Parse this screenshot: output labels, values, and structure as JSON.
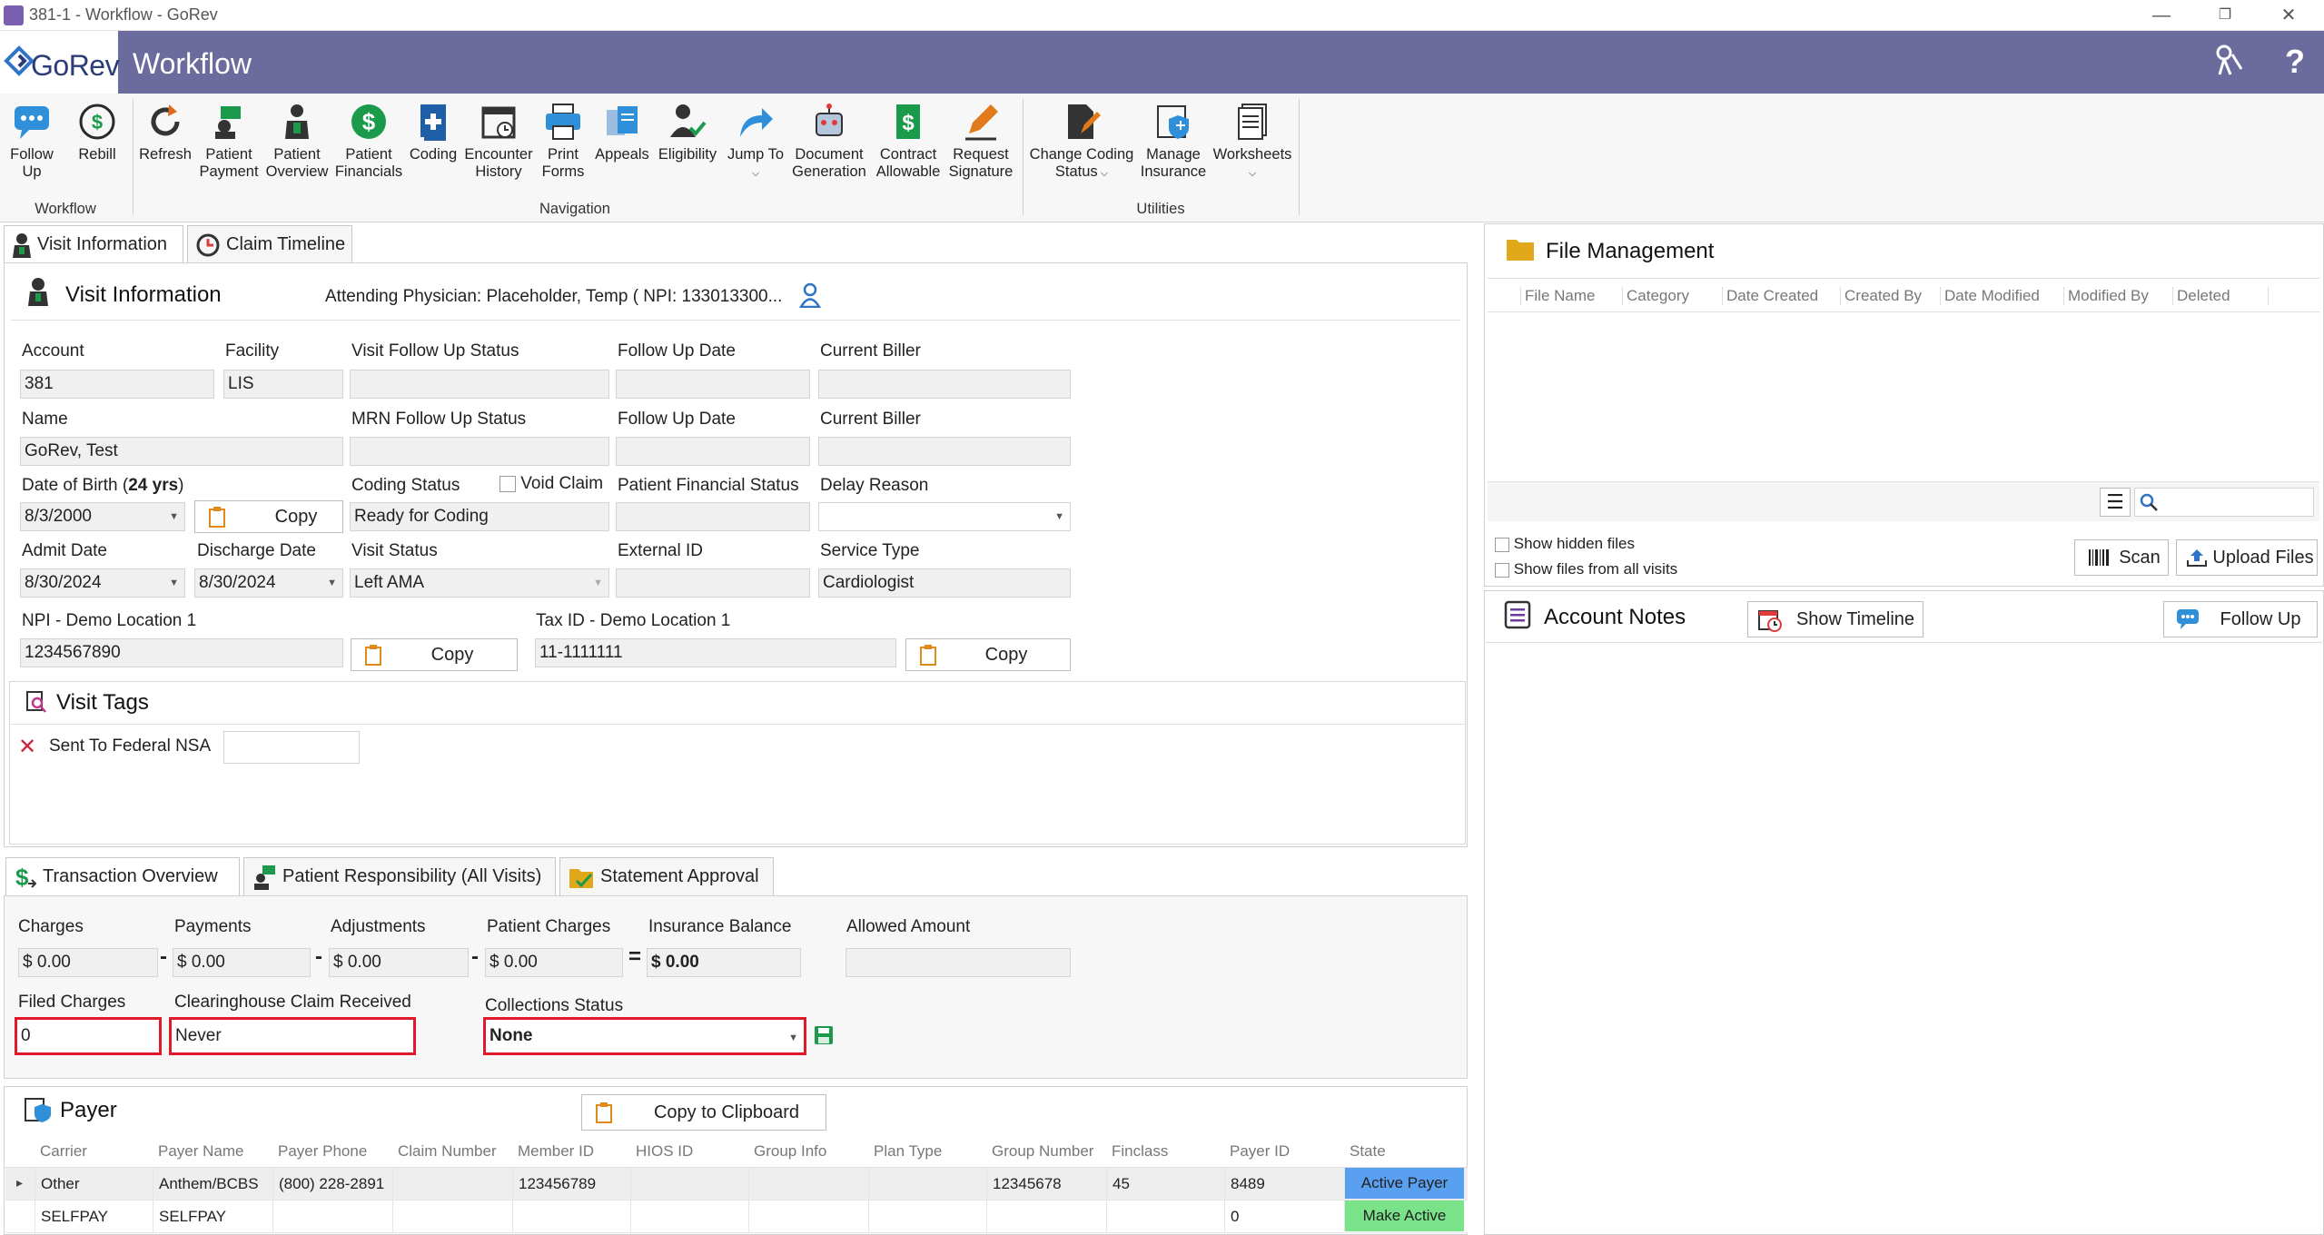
{
  "window": {
    "title": "381-1 - Workflow - GoRev"
  },
  "header": {
    "logo_text": "GoRev",
    "title": "Workflow"
  },
  "ribbon": {
    "groups": {
      "workflow": "Workflow",
      "navigation": "Navigation",
      "utilities": "Utilities"
    },
    "buttons": {
      "follow_up": [
        "Follow",
        "Up"
      ],
      "rebill": [
        "Rebill"
      ],
      "refresh": [
        "Refresh"
      ],
      "patient_payment": [
        "Patient",
        "Payment"
      ],
      "patient_overview": [
        "Patient",
        "Overview"
      ],
      "patient_financials": [
        "Patient",
        "Financials"
      ],
      "coding": [
        "Coding"
      ],
      "encounter_history": [
        "Encounter",
        "History"
      ],
      "print_forms": [
        "Print",
        "Forms"
      ],
      "appeals": [
        "Appeals"
      ],
      "eligibility": [
        "Eligibility"
      ],
      "jump_to": [
        "Jump To"
      ],
      "document_generation": [
        "Document",
        "Generation"
      ],
      "contract_allowable": [
        "Contract",
        "Allowable"
      ],
      "request_signature": [
        "Request",
        "Signature"
      ],
      "change_coding_status": [
        "Change Coding",
        "Status"
      ],
      "manage_insurance": [
        "Manage",
        "Insurance"
      ],
      "worksheets": [
        "Worksheets"
      ]
    }
  },
  "tabs": {
    "visit_information": "Visit Information",
    "claim_timeline": "Claim Timeline"
  },
  "visit": {
    "heading": "Visit Information",
    "attending": "Attending Physician: Placeholder, Temp ( NPI: 133013300...",
    "labels": {
      "account": "Account",
      "facility": "Facility",
      "visit_follow_up_status": "Visit Follow Up Status",
      "follow_up_date": "Follow Up Date",
      "current_biller": "Current Biller",
      "name": "Name",
      "mrn_follow_up_status": "MRN Follow Up Status",
      "dob_prefix": "Date of Birth (",
      "dob_age": "24 yrs",
      "dob_suffix": ")",
      "coding_status": "Coding Status",
      "void_claim": "Void Claim",
      "patient_financial_status": "Patient Financial Status",
      "delay_reason": "Delay Reason",
      "admit_date": "Admit Date",
      "discharge_date": "Discharge Date",
      "visit_status": "Visit Status",
      "external_id": "External ID",
      "service_type": "Service Type",
      "npi": "NPI - Demo Location 1",
      "tax_id": "Tax ID - Demo Location 1"
    },
    "values": {
      "account": "381",
      "facility": "LIS",
      "name": "GoRev, Test",
      "dob": "8/3/2000",
      "coding_status": "Ready for Coding",
      "admit_date": "8/30/2024",
      "discharge_date": "8/30/2024",
      "visit_status": "Left AMA",
      "service_type": "Cardiologist",
      "npi": "1234567890",
      "tax_id": "11-1111111"
    },
    "copy_label": "Copy"
  },
  "visit_tags": {
    "heading": "Visit Tags",
    "tag": "Sent To Federal NSA"
  },
  "transaction_tabs": {
    "overview": "Transaction Overview",
    "patient_responsibility": "Patient Responsibility (All Visits)",
    "statement_approval": "Statement Approval"
  },
  "transactions": {
    "labels": {
      "charges": "Charges",
      "payments": "Payments",
      "adjustments": "Adjustments",
      "patient_charges": "Patient Charges",
      "insurance_balance": "Insurance Balance",
      "allowed_amount": "Allowed Amount",
      "filed_charges": "Filed Charges",
      "clearinghouse": "Clearinghouse Claim Received",
      "collections_status": "Collections Status"
    },
    "values": {
      "charges": "$ 0.00",
      "payments": "$ 0.00",
      "adjustments": "$ 0.00",
      "patient_charges": "$ 0.00",
      "insurance_balance": "$ 0.00",
      "filed_charges": "0",
      "clearinghouse": "Never",
      "collections_status": "None"
    },
    "ops": {
      "minus": "-",
      "equals": "="
    }
  },
  "payer": {
    "heading": "Payer",
    "copy_button": "Copy to Clipboard",
    "columns": [
      "Carrier",
      "Payer Name",
      "Payer Phone",
      "Claim Number",
      "Member ID",
      "HIOS ID",
      "Group Info",
      "Plan Type",
      "Group Number",
      "Finclass",
      "Payer ID",
      "State"
    ],
    "rows": [
      [
        "Other",
        "Anthem/BCBS",
        "(800) 228-2891",
        "",
        "123456789",
        "",
        "",
        "",
        "12345678",
        "45",
        "8489",
        "Active Payer"
      ],
      [
        "SELFPAY",
        "SELFPAY",
        "",
        "",
        "",
        "",
        "",
        "",
        "",
        "",
        "0",
        "Make Active"
      ]
    ],
    "state_colors": [
      "#5aa0f0",
      "#7ae38a"
    ]
  },
  "file_management": {
    "heading": "File Management",
    "columns": [
      "File Name",
      "Category",
      "Date Created",
      "Created By",
      "Date Modified",
      "Modified By",
      "Deleted"
    ],
    "show_hidden": "Show hidden files",
    "show_all_visits": "Show files from all visits",
    "scan": "Scan",
    "upload": "Upload Files"
  },
  "account_notes": {
    "heading": "Account Notes",
    "show_timeline": "Show Timeline",
    "follow_up": "Follow Up"
  }
}
